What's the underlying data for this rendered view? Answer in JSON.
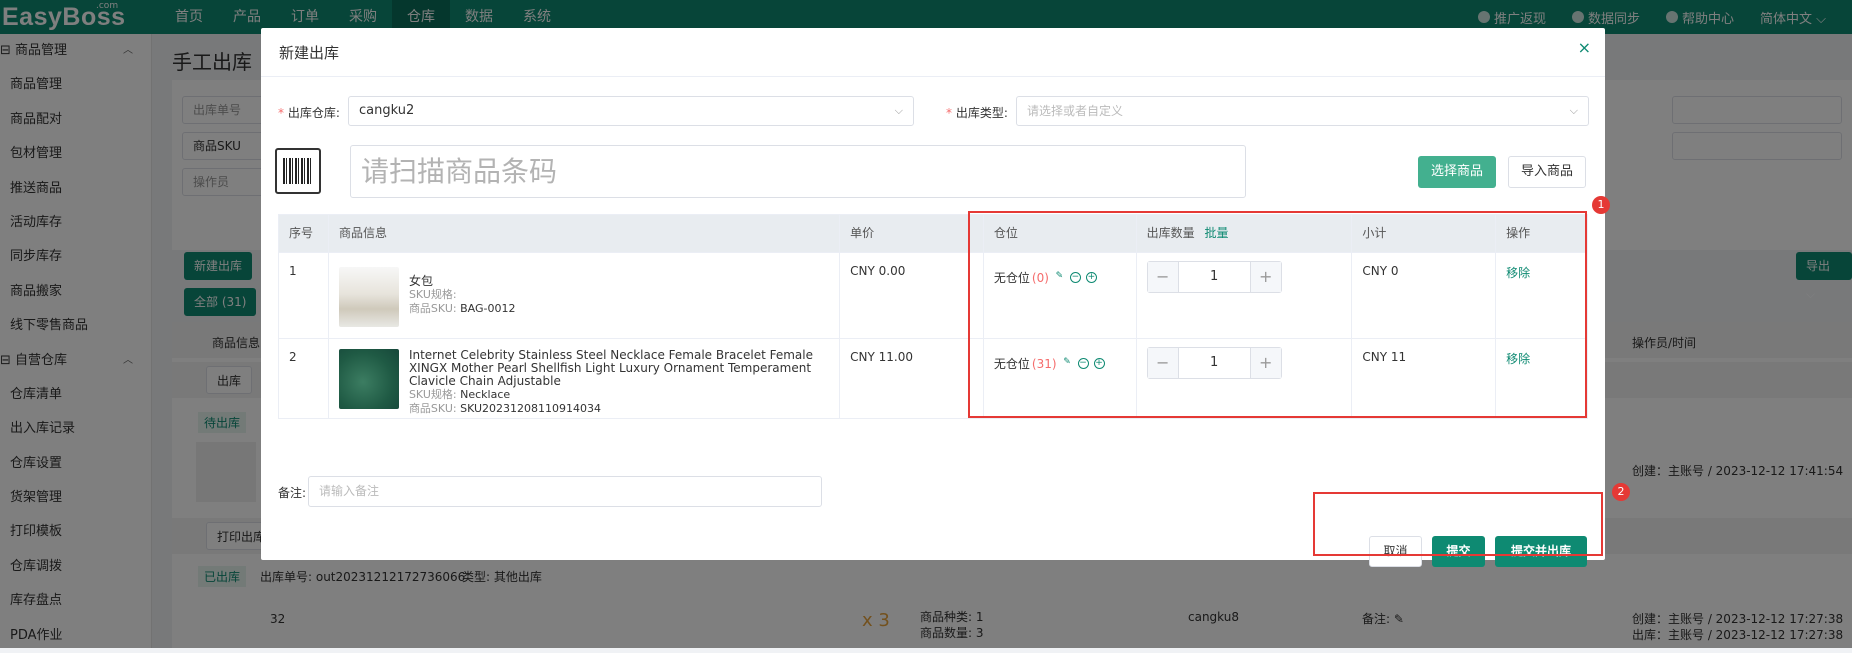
{
  "app": {
    "logo": "EasyBoss",
    "logo_sup": ".com"
  },
  "nav": [
    "首页",
    "产品",
    "订单",
    "采购",
    "仓库",
    "数据",
    "系统"
  ],
  "nav_active": "仓库",
  "topright": [
    "推广返现",
    "数据同步",
    "帮助中心",
    "简体中文 ⌵"
  ],
  "sidebar": [
    {
      "label": "⊟ 商品管理",
      "group": true
    },
    {
      "label": "商品管理"
    },
    {
      "label": "商品配对"
    },
    {
      "label": "包材管理"
    },
    {
      "label": "推送商品"
    },
    {
      "label": "活动库存"
    },
    {
      "label": "同步库存"
    },
    {
      "label": "商品搬家"
    },
    {
      "label": "线下零售商品"
    },
    {
      "label": "⊟ 自营仓库",
      "group": true
    },
    {
      "label": "仓库清单"
    },
    {
      "label": "出入库记录"
    },
    {
      "label": "仓库设置"
    },
    {
      "label": "货架管理"
    },
    {
      "label": "打印模板"
    },
    {
      "label": "仓库调拨"
    },
    {
      "label": "库存盘点"
    },
    {
      "label": "PDA作业"
    }
  ],
  "bg": {
    "page_title": "手工出库",
    "filter_order": "出库单号",
    "filter_sku": "商品SKU",
    "filter_operator": "操作员",
    "new_btn": "新建出库",
    "tab_all": "全部 (31)",
    "export_btn": "导出 ⌵",
    "col_product": "商品信息",
    "col_operator_time": "操作员/时间",
    "out_btn": "出库",
    "pending_badge": "待出库",
    "created_1": "创建：主账号 / 2023-12-12 17:41:54",
    "print_btn": "打印出库单",
    "done_badge": "已出库",
    "order_no": "出库单号: out20231212172736066",
    "order_type": "类型:   其他出库",
    "row2_num": "32",
    "row2_qty": "x 3",
    "row2_kinds": "商品种类: 1",
    "row2_count": "商品数量: 3",
    "row2_wh": "cangku8",
    "row2_remark": "备注: ✎",
    "created_2": "创建：主账号 / 2023-12-12 17:27:38",
    "out_2": "出库：主账号 / 2023-12-12 17:27:38"
  },
  "modal": {
    "title": "新建出库",
    "close": "×",
    "warehouse_label": "出库仓库:",
    "warehouse_value": "cangku2",
    "type_label": "出库类型:",
    "type_placeholder": "请选择或者自定义",
    "scan_placeholder": "请扫描商品条码",
    "select_btn": "选择商品",
    "import_btn": "导入商品",
    "headers": {
      "seq": "序号",
      "info": "商品信息",
      "price": "单价",
      "pos": "仓位",
      "qty": "出库数量",
      "batch": "批量",
      "subtotal": "小计",
      "op": "操作"
    },
    "rows": [
      {
        "seq": "1",
        "name": "女包",
        "spec_label": "SKU规格:",
        "spec": "",
        "sku_label": "商品SKU:",
        "sku": "BAG-0012",
        "price": "CNY 0.00",
        "pos": "无仓位",
        "pos_count": "(0)",
        "qty": "1",
        "subtotal": "CNY 0",
        "op": "移除"
      },
      {
        "seq": "2",
        "name": "Internet Celebrity Stainless Steel Necklace Female Bracelet Female XINGX Mother Pearl Shellfish Light Luxury Ornament Temperament Clavicle Chain Adjustable",
        "spec_label": "SKU规格:",
        "spec": "Necklace",
        "sku_label": "商品SKU:",
        "sku": "SKU20231208110914034",
        "price": "CNY 11.00",
        "pos": "无仓位",
        "pos_count": "(31)",
        "qty": "1",
        "subtotal": "CNY 11",
        "op": "移除"
      }
    ],
    "remark_label": "备注:",
    "remark_placeholder": "请输入备注",
    "cancel_btn": "取消",
    "submit_btn": "提交",
    "submit_out_btn": "提交并出库"
  },
  "annotations": {
    "badge1": "1",
    "badge2": "2",
    "color": "#e53935"
  }
}
